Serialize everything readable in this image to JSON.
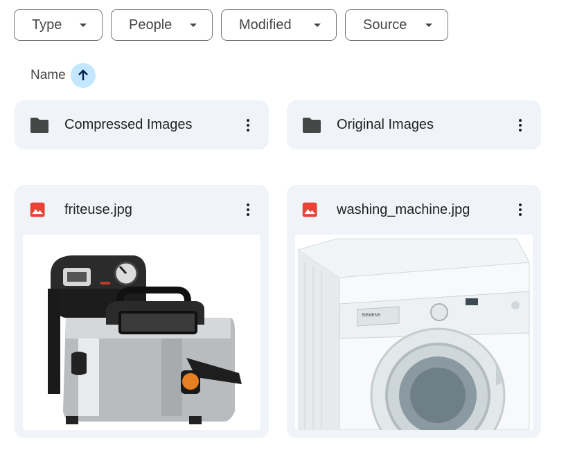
{
  "filters": {
    "type_label": "Type",
    "people_label": "People",
    "modified_label": "Modified",
    "source_label": "Source"
  },
  "sort": {
    "label": "Name",
    "direction_icon": "arrow-up-icon"
  },
  "folders": [
    {
      "name": "Compressed Images",
      "icon": "folder-icon"
    },
    {
      "name": "Original Images",
      "icon": "folder-icon"
    }
  ],
  "files": [
    {
      "name": "friteuse.jpg",
      "icon": "image-file-icon"
    },
    {
      "name": "washing_machine.jpg",
      "icon": "image-file-icon"
    }
  ],
  "thumbnails": {
    "washer_brand": "SIEMENS"
  },
  "colors": {
    "card_bg": "#f0f4f9",
    "sort_accent": "#c2e7ff",
    "image_icon": "#ea4335",
    "folder_icon": "#444746"
  }
}
